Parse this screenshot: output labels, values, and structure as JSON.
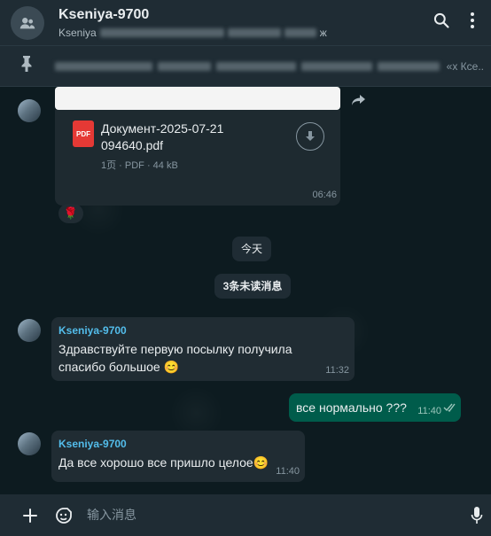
{
  "header": {
    "title": "Kseniya-9700",
    "subtitle_prefix": "Kseniya",
    "subtitle_suffix": "ж"
  },
  "pinned": {
    "text_tail": "«х Ксе.."
  },
  "messages": {
    "document": {
      "filename": "Документ-2025-07-21 094640.pdf",
      "meta": "1页 · PDF · 44 kB",
      "time": "06:46",
      "reaction": "🌹"
    },
    "date_divider": "今天",
    "unread_divider": "3条未读消息",
    "msg1": {
      "sender": "Kseniya-9700",
      "text": "Здравствуйте первую посылку получила спасибо большое 😊",
      "time": "11:32"
    },
    "msg2": {
      "text": "все  нормально ???",
      "time": "11:40"
    },
    "msg3": {
      "sender": "Kseniya-9700",
      "text": "Да все хорошо все пришло целое😊",
      "time": "11:40"
    }
  },
  "composer": {
    "placeholder": "输入消息"
  },
  "colors": {
    "background": "#0b141a",
    "bubble_in": "#202c33",
    "bubble_out": "#005c4b",
    "sender_name": "#53bdeb",
    "pdf_red": "#e53935"
  },
  "icons": [
    "group-avatar-icon",
    "search-icon",
    "more-vertical-icon",
    "pin-icon",
    "forward-icon",
    "download-icon",
    "pdf-icon",
    "double-check-icon",
    "plus-icon",
    "sticker-icon",
    "microphone-icon"
  ]
}
